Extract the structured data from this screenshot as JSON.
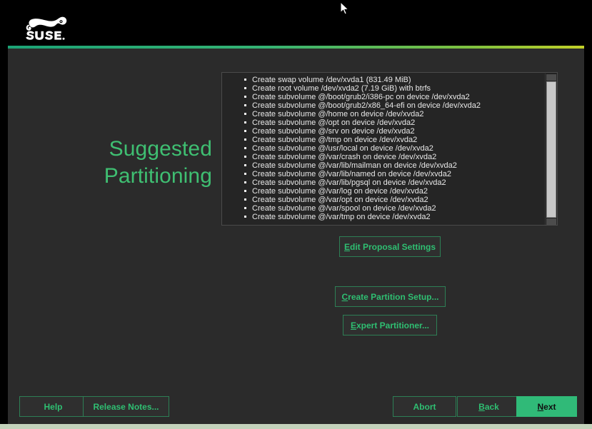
{
  "header": {
    "logo_name": "suse-chameleon-logo",
    "wordmark": "SUSE."
  },
  "colors": {
    "accent_green": "#30ba78",
    "title_green": "#3fbf72",
    "button_border": "#2d7f55",
    "panel_bg": "#2b2b2b",
    "listbox_bg": "#252525",
    "page_bg": "#000000",
    "bottom_band": "#c3d2bb",
    "rule_gradient_start": "#1ca376",
    "rule_gradient_end": "#c2d028"
  },
  "main": {
    "page_title_line1": "Suggested",
    "page_title_line2": "Partitioning",
    "proposal_items": [
      "Create swap volume /dev/xvda1 (831.49 MiB)",
      "Create root volume /dev/xvda2 (7.19 GiB) with btrfs",
      "Create subvolume @/boot/grub2/i386-pc on device /dev/xvda2",
      "Create subvolume @/boot/grub2/x86_64-efi on device /dev/xvda2",
      "Create subvolume @/home on device /dev/xvda2",
      "Create subvolume @/opt on device /dev/xvda2",
      "Create subvolume @/srv on device /dev/xvda2",
      "Create subvolume @/tmp on device /dev/xvda2",
      "Create subvolume @/usr/local on device /dev/xvda2",
      "Create subvolume @/var/crash on device /dev/xvda2",
      "Create subvolume @/var/lib/mailman on device /dev/xvda2",
      "Create subvolume @/var/lib/named on device /dev/xvda2",
      "Create subvolume @/var/lib/pgsql on device /dev/xvda2",
      "Create subvolume @/var/log on device /dev/xvda2",
      "Create subvolume @/var/opt on device /dev/xvda2",
      "Create subvolume @/var/spool on device /dev/xvda2",
      "Create subvolume @/var/tmp on device /dev/xvda2"
    ],
    "actions": {
      "edit_proposal": {
        "accel": "E",
        "rest": "dit Proposal Settings"
      },
      "create_partition_setup": {
        "accel": "C",
        "rest": "reate Partition Setup..."
      },
      "expert_partitioner": {
        "accel": "E",
        "rest": "xpert Partitioner..."
      }
    }
  },
  "footer": {
    "help": {
      "accel": "",
      "rest": "Help"
    },
    "release_notes": {
      "accel": "",
      "rest": "Release Notes..."
    },
    "abort": {
      "accel": "",
      "rest": "Abort"
    },
    "back": {
      "accel": "B",
      "rest": "ack"
    },
    "next": {
      "accel": "N",
      "rest": "ext"
    }
  }
}
